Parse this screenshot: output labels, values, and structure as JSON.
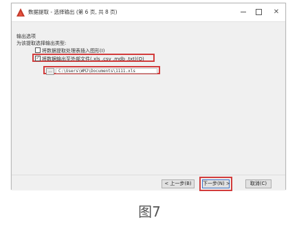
{
  "window": {
    "title": "数据提取 - 选择输出 (第 6 页, 共 8 页)",
    "icon": "autocad-app-icon",
    "controls": {
      "minimize": "minimize-icon",
      "maximize": "maximize-icon",
      "close": "✕"
    }
  },
  "output_options": {
    "section_title": "输出选项",
    "subtitle": "为该提取选择输出类型:",
    "options": [
      {
        "label": "将数据提取处理表插入图形(I)",
        "checked": false
      },
      {
        "label": "将数据输出至外部文件(.xls .csv .mdb .txt)(O)",
        "checked": true
      }
    ],
    "browse_label": "...",
    "file_path": "C:\\Users\\WMJ\\Documents\\1111.xls"
  },
  "buttons": {
    "back": "< 上一步(B)",
    "next": "下一步(N) >",
    "cancel": "取消(C)"
  },
  "caption": "图7",
  "colors": {
    "highlight": "#d23b3b",
    "app_icon": "#c0392b"
  }
}
